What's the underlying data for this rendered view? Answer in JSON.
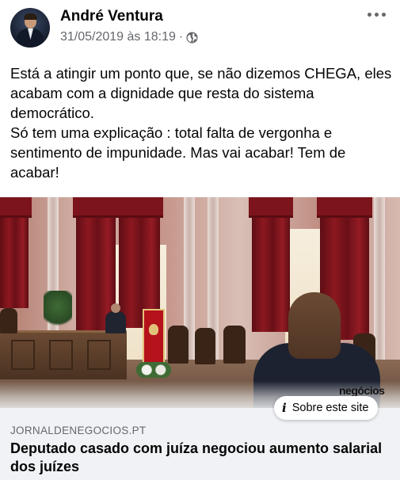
{
  "post": {
    "author": "André Ventura",
    "timestamp": "31/05/2019 às 18:19",
    "separator": "·",
    "privacy_icon": "globe-icon",
    "more_icon": "more-options-icon",
    "text_paragraphs": [
      "Está a atingir um ponto que, se não dizemos CHEGA, eles acabam com a dignidade que resta do sistema democrático.",
      "Só tem uma explicação : total falta de vergonha e sentimento de impunidade. Mas vai acabar! Tem de acabar!"
    ]
  },
  "link_preview": {
    "image_watermark": "negócios",
    "about_site_icon": "info-icon",
    "about_site_label": "Sobre este site",
    "domain": "JORNALDENEGOCIOS.PT",
    "headline": "Deputado casado com juíza negociou aumento salarial dos juízes"
  },
  "colors": {
    "text_primary": "#050505",
    "text_secondary": "#65676b",
    "link_box_bg": "#f0f2f5"
  }
}
